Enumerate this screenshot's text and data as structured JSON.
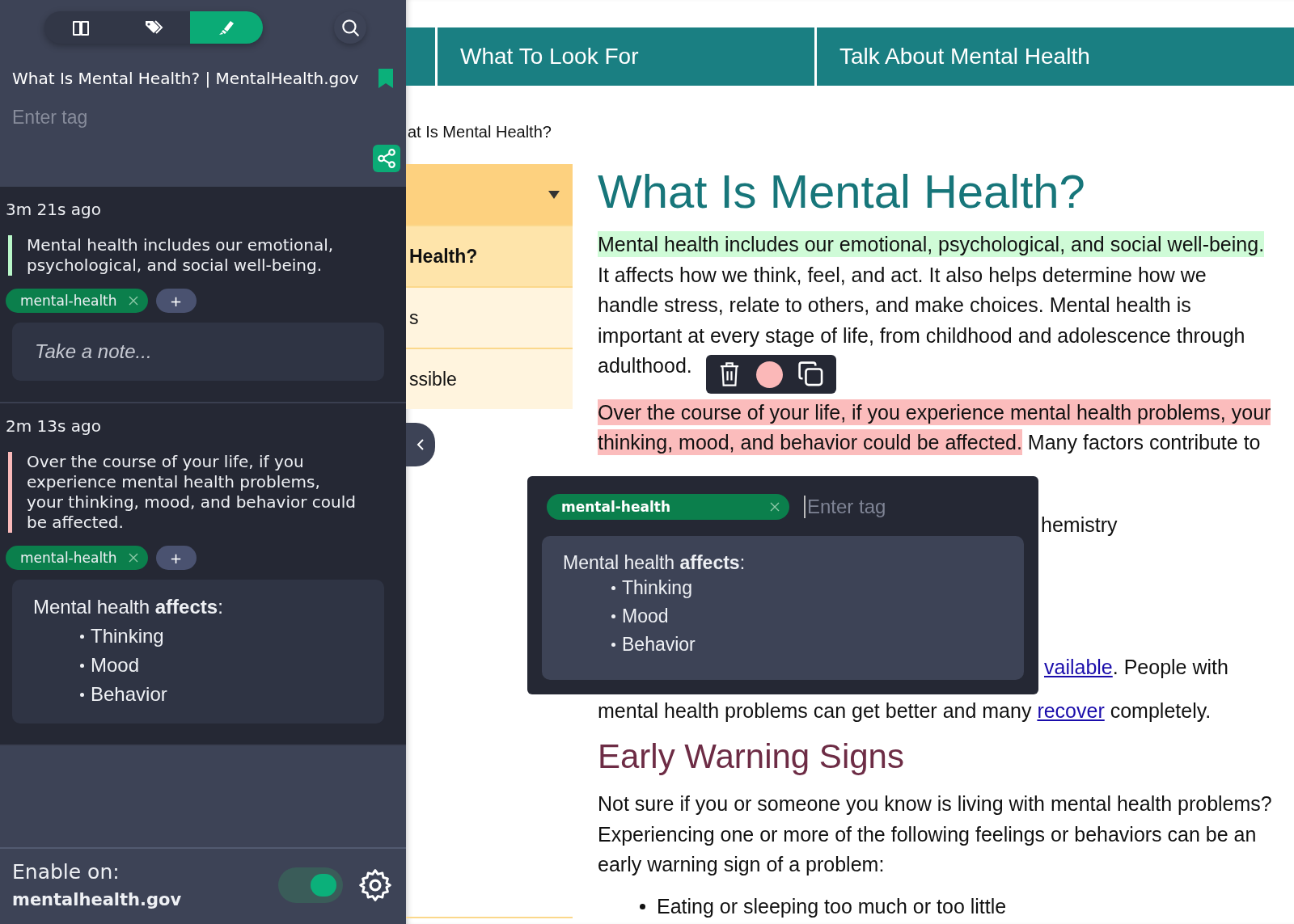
{
  "sidebar": {
    "tabs": [
      {
        "kind": "book",
        "selected": false
      },
      {
        "kind": "tags",
        "selected": false
      },
      {
        "kind": "highlighter",
        "selected": true
      }
    ],
    "page_title": "What Is Mental Health? | MentalHealth.gov",
    "bookmarked": true,
    "tag_input": {
      "placeholder": "Enter tag"
    },
    "highlights": [
      {
        "time": "3m 21s ago",
        "text": "Mental health includes our emotional, psychological, and social well-being.",
        "color": "#b9f7c9",
        "tags": [
          {
            "label": "mental-health"
          }
        ],
        "add_tag": "+",
        "note": {
          "placeholder": "Take a note..."
        }
      },
      {
        "time": "2m 13s ago",
        "text": "Over the course of your life, if you experience mental health problems, your thinking, mood, and behavior could be affected.",
        "color": "#f9b9b9",
        "tags": [
          {
            "label": "mental-health"
          }
        ],
        "add_tag": "+",
        "note": {
          "title": "Mental health **affects**:",
          "items": [
            "Thinking",
            "Mood",
            "Behavior"
          ]
        }
      }
    ],
    "footer": {
      "label": "Enable on:",
      "site": "mentalhealth.gov",
      "on": true
    }
  },
  "webpage": {
    "nav": [
      "What To Look For",
      "Talk About Mental Health"
    ],
    "breadcrumb": "at Is Mental Health?",
    "side_menu": [
      {
        "label": "Health?",
        "selected": true
      },
      {
        "label": "s",
        "selected": false
      },
      {
        "label": "ssible",
        "selected": false
      }
    ],
    "heading": "What Is Mental Health?",
    "paragraph_1": [
      {
        "text": "Mental health includes our emotional, psychological, and social well-being.",
        "color": "#cffbd7"
      },
      {
        "text": " It affects how we think, feel, and act. It also helps determine how we handle stress, relate to others, and make choices. Mental health is important at every stage of life, from childhood and adolescence through adulthood."
      }
    ],
    "paragraph_2": [
      {
        "text": "Over the course of your life, if you experience mental health problems, your thinking, mood, and behavior could be affected.",
        "color": "#fbbcbc"
      },
      {
        "text": " Many factors contribute to"
      }
    ],
    "fragment_1": "hemistry",
    "fragment_2": {
      "link": "vailable",
      "text": ". People with"
    },
    "fragment_3": {
      "before": "mental health problems can get better and many ",
      "link": "recover",
      "after": " completely."
    },
    "heading_2": "Early Warning Signs",
    "paragraph_3": "Not sure if you or someone you know is living with mental health problems? Experiencing one or more of the following feelings or behaviors can be an early warning sign of a problem:",
    "bullets": [
      "Eating or sleeping too much or too little"
    ]
  },
  "highlight_toolbar": {
    "color": "#fbb8b8"
  },
  "tag_popup": {
    "tags": [
      {
        "label": "mental-health"
      }
    ],
    "input": {
      "placeholder": "Enter tag"
    },
    "note": {
      "title": "Mental health **affects**:",
      "items": [
        "Thinking",
        "Mood",
        "Behavior"
      ]
    }
  }
}
